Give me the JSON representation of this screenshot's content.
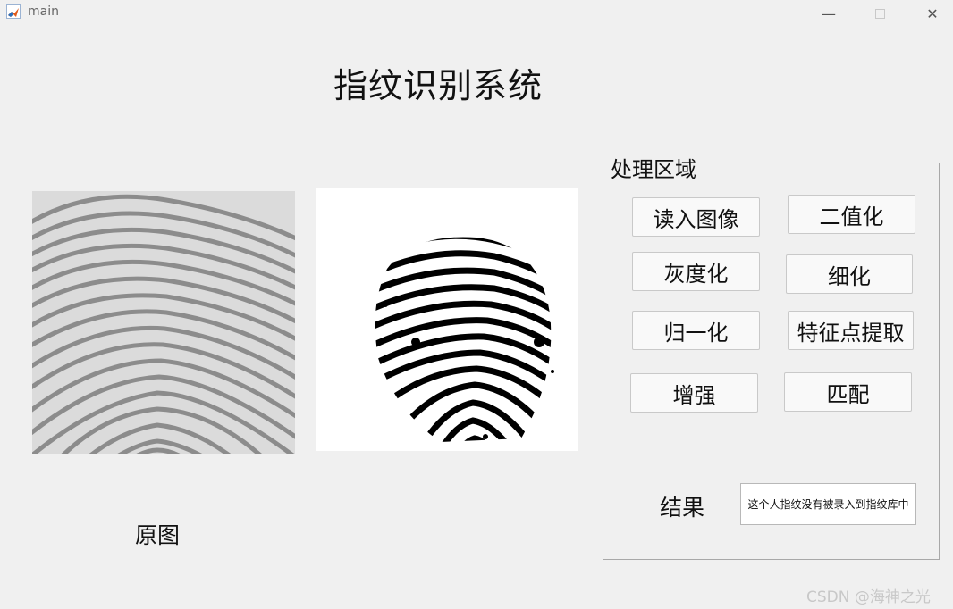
{
  "window": {
    "title": "main",
    "minimize_symbol": "—",
    "close_symbol": "✕",
    "app_icon": "matlab-icon"
  },
  "page": {
    "title": "指纹识别系统"
  },
  "images": {
    "original_caption": "原图",
    "original_icon": "fingerprint-grayscale-image",
    "processed_icon": "fingerprint-binary-image"
  },
  "panel": {
    "title": "处理区域",
    "buttons": {
      "read": "读入图像",
      "binarize": "二值化",
      "grayscale": "灰度化",
      "thin": "细化",
      "normalize": "归一化",
      "features": "特征点提取",
      "enhance": "增强",
      "match": "匹配"
    },
    "result_label": "结果",
    "result_value": "这个人指纹没有被录入到指纹库中"
  },
  "watermark": "CSDN @海神之光"
}
